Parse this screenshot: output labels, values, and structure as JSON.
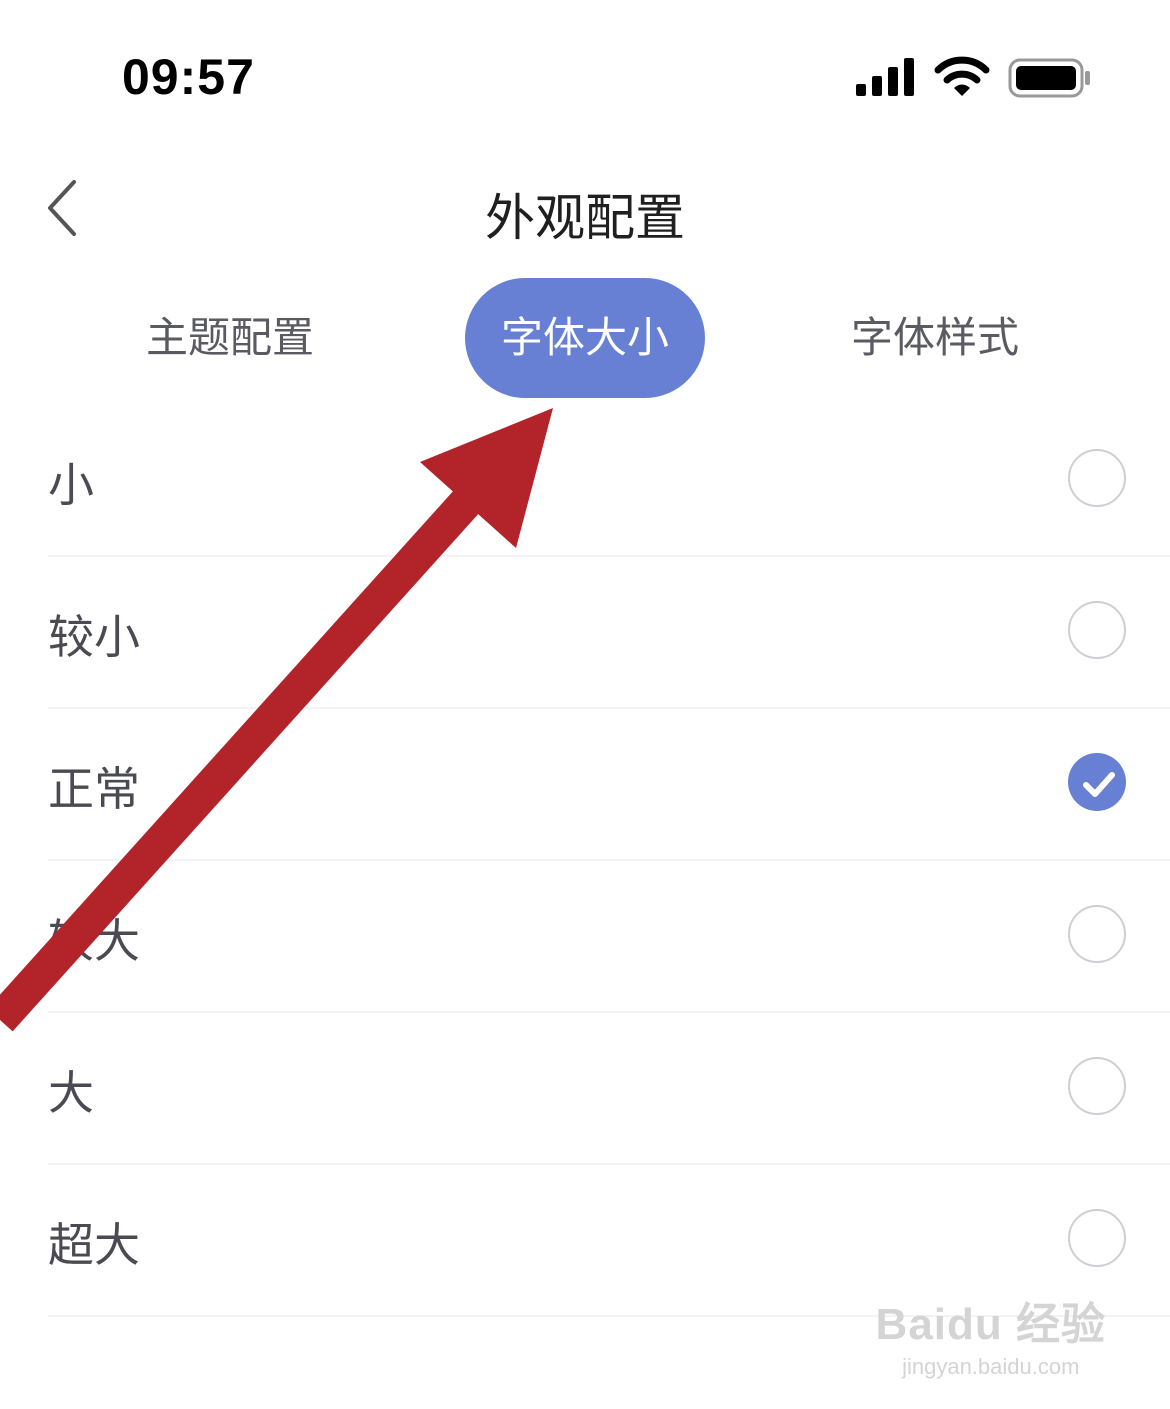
{
  "status_bar": {
    "time": "09:57"
  },
  "nav": {
    "title": "外观配置"
  },
  "tabs": [
    {
      "label": "主题配置",
      "active": false
    },
    {
      "label": "字体大小",
      "active": true
    },
    {
      "label": "字体样式",
      "active": false
    }
  ],
  "font_sizes": [
    {
      "label": "小",
      "selected": false
    },
    {
      "label": "较小",
      "selected": false
    },
    {
      "label": "正常",
      "selected": true
    },
    {
      "label": "较大",
      "selected": false
    },
    {
      "label": "大",
      "selected": false
    },
    {
      "label": "超大",
      "selected": false
    }
  ],
  "watermark": {
    "main": "Baidu 经验",
    "sub": "jingyan.baidu.com"
  },
  "colors": {
    "accent": "#6780d4",
    "annotation_arrow": "#b3232a"
  }
}
